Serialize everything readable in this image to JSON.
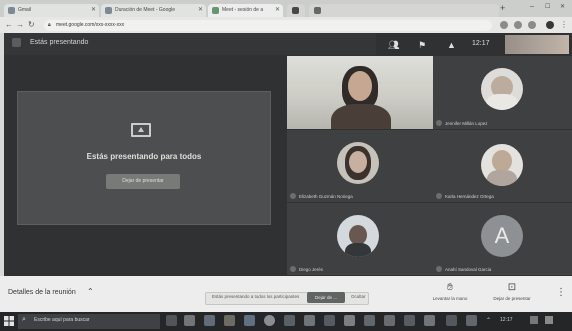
{
  "browser": {
    "tabs": [
      "Gmail",
      "Duración de Meet - Google",
      "Meet - sesión de a",
      "",
      ""
    ],
    "url": "meet.google.com/xxx-xxxx-xxx"
  },
  "meet": {
    "presenter_label": "Estás presentando",
    "present_title": "Estás presentando para todos",
    "stop_button": "Dejar de presentar",
    "clock": "12:17",
    "participants": [
      {
        "name": ""
      },
      {
        "name": "Jennifer Millán Lopez"
      },
      {
        "name": "Elizabeth Guzmán Noriega"
      },
      {
        "name": "Karla Hernández Ortega"
      },
      {
        "name": "Diego Jerés"
      },
      {
        "name": "Anahí Sandoval Garcia",
        "initial": "A"
      }
    ]
  },
  "bottombar": {
    "details_label": "Detalles de la reunión",
    "toast_text": "Estás presentando a todos los participantes",
    "toast_stop": "Dejar de ...",
    "toast_hide": "Ocultar",
    "controls": [
      "Levantar la mano",
      "Dejar de presentar"
    ]
  },
  "taskbar": {
    "search_text": "Escribe aquí para buscar",
    "clock": "12:17"
  }
}
